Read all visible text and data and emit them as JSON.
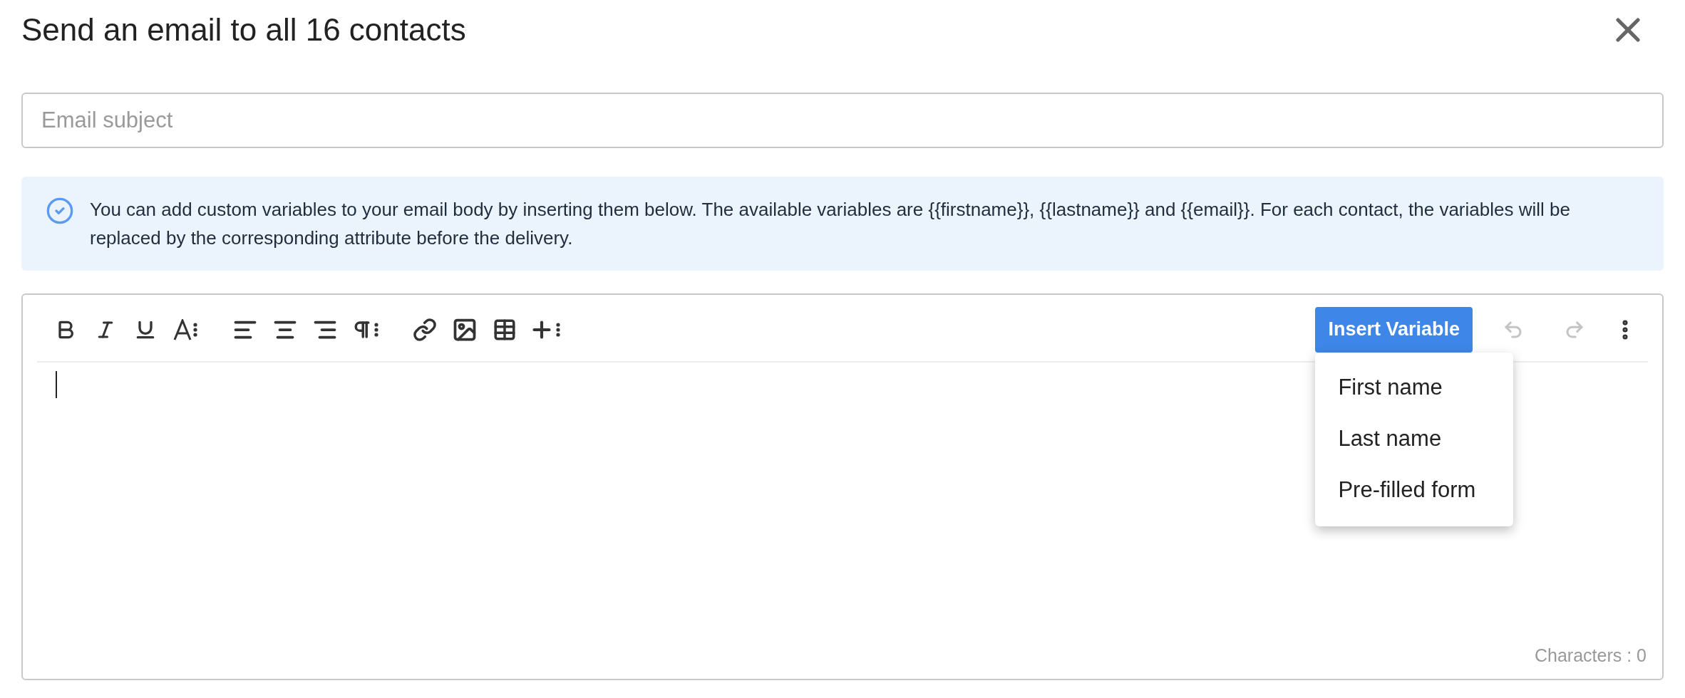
{
  "dialog": {
    "title": "Send an email to all 16 contacts"
  },
  "subject": {
    "placeholder": "Email subject"
  },
  "info": {
    "text": "You can add custom variables to your email body by inserting them below. The available variables are {{firstname}}, {{lastname}} and {{email}}. For each contact, the variables will be replaced by the corresponding attribute before the delivery."
  },
  "editor": {
    "insert_button": "Insert Variable",
    "history_buttons": [
      {
        "kind": "undo",
        "disabled": true
      },
      {
        "kind": "redo",
        "disabled": true
      }
    ],
    "menu": [
      {
        "label": "First name"
      },
      {
        "label": "Last name"
      },
      {
        "label": "Pre-filled form"
      }
    ],
    "counter": "Characters : 0"
  }
}
